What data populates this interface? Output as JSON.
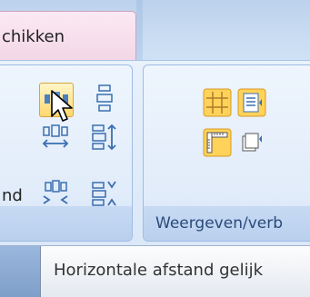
{
  "tabs": {
    "active_label": "chikken"
  },
  "groups": {
    "group1": {
      "truncated_label": "nd"
    },
    "group2": {
      "label": "Weergeven/verb"
    }
  },
  "tooltip": {
    "text": "Horizontale afstand gelijk"
  },
  "icons": {
    "btn1": "distribute-horizontal-icon",
    "btn2": "distribute-vertical-icon",
    "btn3": "increase-horizontal-spacing-icon",
    "btn4": "increase-vertical-spacing-icon",
    "btn5": "decrease-horizontal-spacing-icon",
    "btn6": "decrease-vertical-spacing-icon",
    "btn7": "gridlines-icon",
    "btn8": "properties-panel-icon",
    "btn9": "ruler-icon",
    "btn10": "page-setup-icon"
  },
  "colors": {
    "hover": "#ffd86e",
    "accent": "#2a4a7a"
  }
}
